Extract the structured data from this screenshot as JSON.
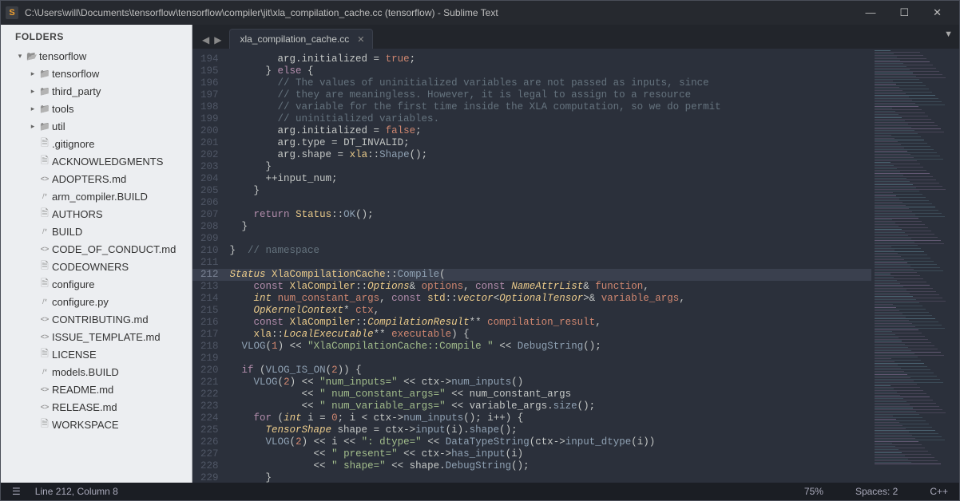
{
  "titlebar": {
    "app_initial": "S",
    "title": "C:\\Users\\will\\Documents\\tensorflow\\tensorflow\\compiler\\jit\\xla_compilation_cache.cc (tensorflow) - Sublime Text"
  },
  "sidebar": {
    "header": "FOLDERS",
    "root": "tensorflow",
    "folders": [
      "tensorflow",
      "third_party",
      "tools",
      "util"
    ],
    "files": [
      {
        "label": ".gitignore",
        "icon": "file"
      },
      {
        "label": "ACKNOWLEDGMENTS",
        "icon": "file"
      },
      {
        "label": "ADOPTERS.md",
        "icon": "code"
      },
      {
        "label": "arm_compiler.BUILD",
        "icon": "slash"
      },
      {
        "label": "AUTHORS",
        "icon": "file"
      },
      {
        "label": "BUILD",
        "icon": "slash"
      },
      {
        "label": "CODE_OF_CONDUCT.md",
        "icon": "code"
      },
      {
        "label": "CODEOWNERS",
        "icon": "file"
      },
      {
        "label": "configure",
        "icon": "file"
      },
      {
        "label": "configure.py",
        "icon": "slash"
      },
      {
        "label": "CONTRIBUTING.md",
        "icon": "code"
      },
      {
        "label": "ISSUE_TEMPLATE.md",
        "icon": "code"
      },
      {
        "label": "LICENSE",
        "icon": "file"
      },
      {
        "label": "models.BUILD",
        "icon": "slash"
      },
      {
        "label": "README.md",
        "icon": "code"
      },
      {
        "label": "RELEASE.md",
        "icon": "code"
      },
      {
        "label": "WORKSPACE",
        "icon": "file"
      }
    ]
  },
  "tab": {
    "label": "xla_compilation_cache.cc"
  },
  "gutter": {
    "start": 194,
    "end": 229,
    "highlight": 212
  },
  "code_lines": [
    {
      "n": 194,
      "html": "        arg.initialized <span class='op'>=</span> <span class='bool'>true</span>;"
    },
    {
      "n": 195,
      "html": "      } <span class='kw'>else</span> {"
    },
    {
      "n": 196,
      "html": "        <span class='cm'>// The values of uninitialized variables are not passed as inputs, since</span>"
    },
    {
      "n": 197,
      "html": "        <span class='cm'>// they are meaningless. However, it is legal to assign to a resource</span>"
    },
    {
      "n": 198,
      "html": "        <span class='cm'>// variable for the first time inside the XLA computation, so we do permit</span>"
    },
    {
      "n": 199,
      "html": "        <span class='cm'>// uninitialized variables.</span>"
    },
    {
      "n": 200,
      "html": "        arg.initialized <span class='op'>=</span> <span class='bool'>false</span>;"
    },
    {
      "n": 201,
      "html": "        arg.type <span class='op'>=</span> DT_INVALID;"
    },
    {
      "n": 202,
      "html": "        arg.shape <span class='op'>=</span> <span class='ns'>xla</span>::<span class='call'>Shape</span>();"
    },
    {
      "n": 203,
      "html": "      }"
    },
    {
      "n": 204,
      "html": "      <span class='op'>++</span>input_num;"
    },
    {
      "n": 205,
      "html": "    }"
    },
    {
      "n": 206,
      "html": ""
    },
    {
      "n": 207,
      "html": "    <span class='kw'>return</span> <span class='ns'>Status</span>::<span class='call'>OK</span>();"
    },
    {
      "n": 208,
      "html": "  }"
    },
    {
      "n": 209,
      "html": ""
    },
    {
      "n": 210,
      "html": "}  <span class='cm'>// namespace</span>"
    },
    {
      "n": 211,
      "html": ""
    },
    {
      "n": 212,
      "hl": true,
      "html": "<span class='type'>Status</span> <span class='ns'>XlaCompilationCache</span>::<span class='call'>Compile</span>("
    },
    {
      "n": 213,
      "html": "    <span class='kw'>const</span> <span class='ns'>XlaCompiler</span>::<span class='type'>Options</span><span class='op'>&amp;</span> <span class='ident'>options</span>, <span class='kw'>const</span> <span class='type'>NameAttrList</span><span class='op'>&amp;</span> <span class='ident'>function</span>,"
    },
    {
      "n": 214,
      "html": "    <span class='type'>int</span> <span class='ident'>num_constant_args</span>, <span class='kw'>const</span> <span class='ns'>std</span>::<span class='type'>vector</span>&lt;<span class='type'>OptionalTensor</span>&gt;<span class='op'>&amp;</span> <span class='ident'>variable_args</span>,"
    },
    {
      "n": 215,
      "html": "    <span class='type'>OpKernelContext</span><span class='op'>*</span> <span class='ident'>ctx</span>,"
    },
    {
      "n": 216,
      "html": "    <span class='kw'>const</span> <span class='ns'>XlaCompiler</span>::<span class='type'>CompilationResult</span><span class='op'>**</span> <span class='ident'>compilation_result</span>,"
    },
    {
      "n": 217,
      "html": "    <span class='ns'>xla</span>::<span class='type'>LocalExecutable</span><span class='op'>**</span> <span class='ident'>executable</span>) {"
    },
    {
      "n": 218,
      "html": "  <span class='call'>VLOG</span>(<span class='num'>1</span>) <span class='op'>&lt;&lt;</span> <span class='str'>\"XlaCompilationCache::Compile \"</span> <span class='op'>&lt;&lt;</span> <span class='call'>DebugString</span>();"
    },
    {
      "n": 219,
      "html": ""
    },
    {
      "n": 220,
      "html": "  <span class='kw'>if</span> (<span class='call'>VLOG_IS_ON</span>(<span class='num'>2</span>)) {"
    },
    {
      "n": 221,
      "html": "    <span class='call'>VLOG</span>(<span class='num'>2</span>) <span class='op'>&lt;&lt;</span> <span class='str'>\"num_inputs=\"</span> <span class='op'>&lt;&lt;</span> ctx<span class='op'>-&gt;</span><span class='call'>num_inputs</span>()"
    },
    {
      "n": 222,
      "html": "            <span class='op'>&lt;&lt;</span> <span class='str'>\" num_constant_args=\"</span> <span class='op'>&lt;&lt;</span> num_constant_args"
    },
    {
      "n": 223,
      "html": "            <span class='op'>&lt;&lt;</span> <span class='str'>\" num_variable_args=\"</span> <span class='op'>&lt;&lt;</span> variable_args.<span class='call'>size</span>();"
    },
    {
      "n": 224,
      "html": "    <span class='kw'>for</span> (<span class='type'>int</span> i <span class='op'>=</span> <span class='num'>0</span>; i <span class='op'>&lt;</span> ctx<span class='op'>-&gt;</span><span class='call'>num_inputs</span>(); i<span class='op'>++</span>) {"
    },
    {
      "n": 225,
      "html": "      <span class='type'>TensorShape</span> shape <span class='op'>=</span> ctx<span class='op'>-&gt;</span><span class='call'>input</span>(i).<span class='call'>shape</span>();"
    },
    {
      "n": 226,
      "html": "      <span class='call'>VLOG</span>(<span class='num'>2</span>) <span class='op'>&lt;&lt;</span> i <span class='op'>&lt;&lt;</span> <span class='str'>\": dtype=\"</span> <span class='op'>&lt;&lt;</span> <span class='call'>DataTypeString</span>(ctx<span class='op'>-&gt;</span><span class='call'>input_dtype</span>(i))"
    },
    {
      "n": 227,
      "html": "              <span class='op'>&lt;&lt;</span> <span class='str'>\" present=\"</span> <span class='op'>&lt;&lt;</span> ctx<span class='op'>-&gt;</span><span class='call'>has_input</span>(i)"
    },
    {
      "n": 228,
      "html": "              <span class='op'>&lt;&lt;</span> <span class='str'>\" shape=\"</span> <span class='op'>&lt;&lt;</span> shape.<span class='call'>DebugString</span>();"
    },
    {
      "n": 229,
      "html": "      }"
    }
  ],
  "statusbar": {
    "left_icon": "☰",
    "position": "Line 212, Column 8",
    "zoom": "75%",
    "spaces": "Spaces: 2",
    "lang": "C++"
  }
}
